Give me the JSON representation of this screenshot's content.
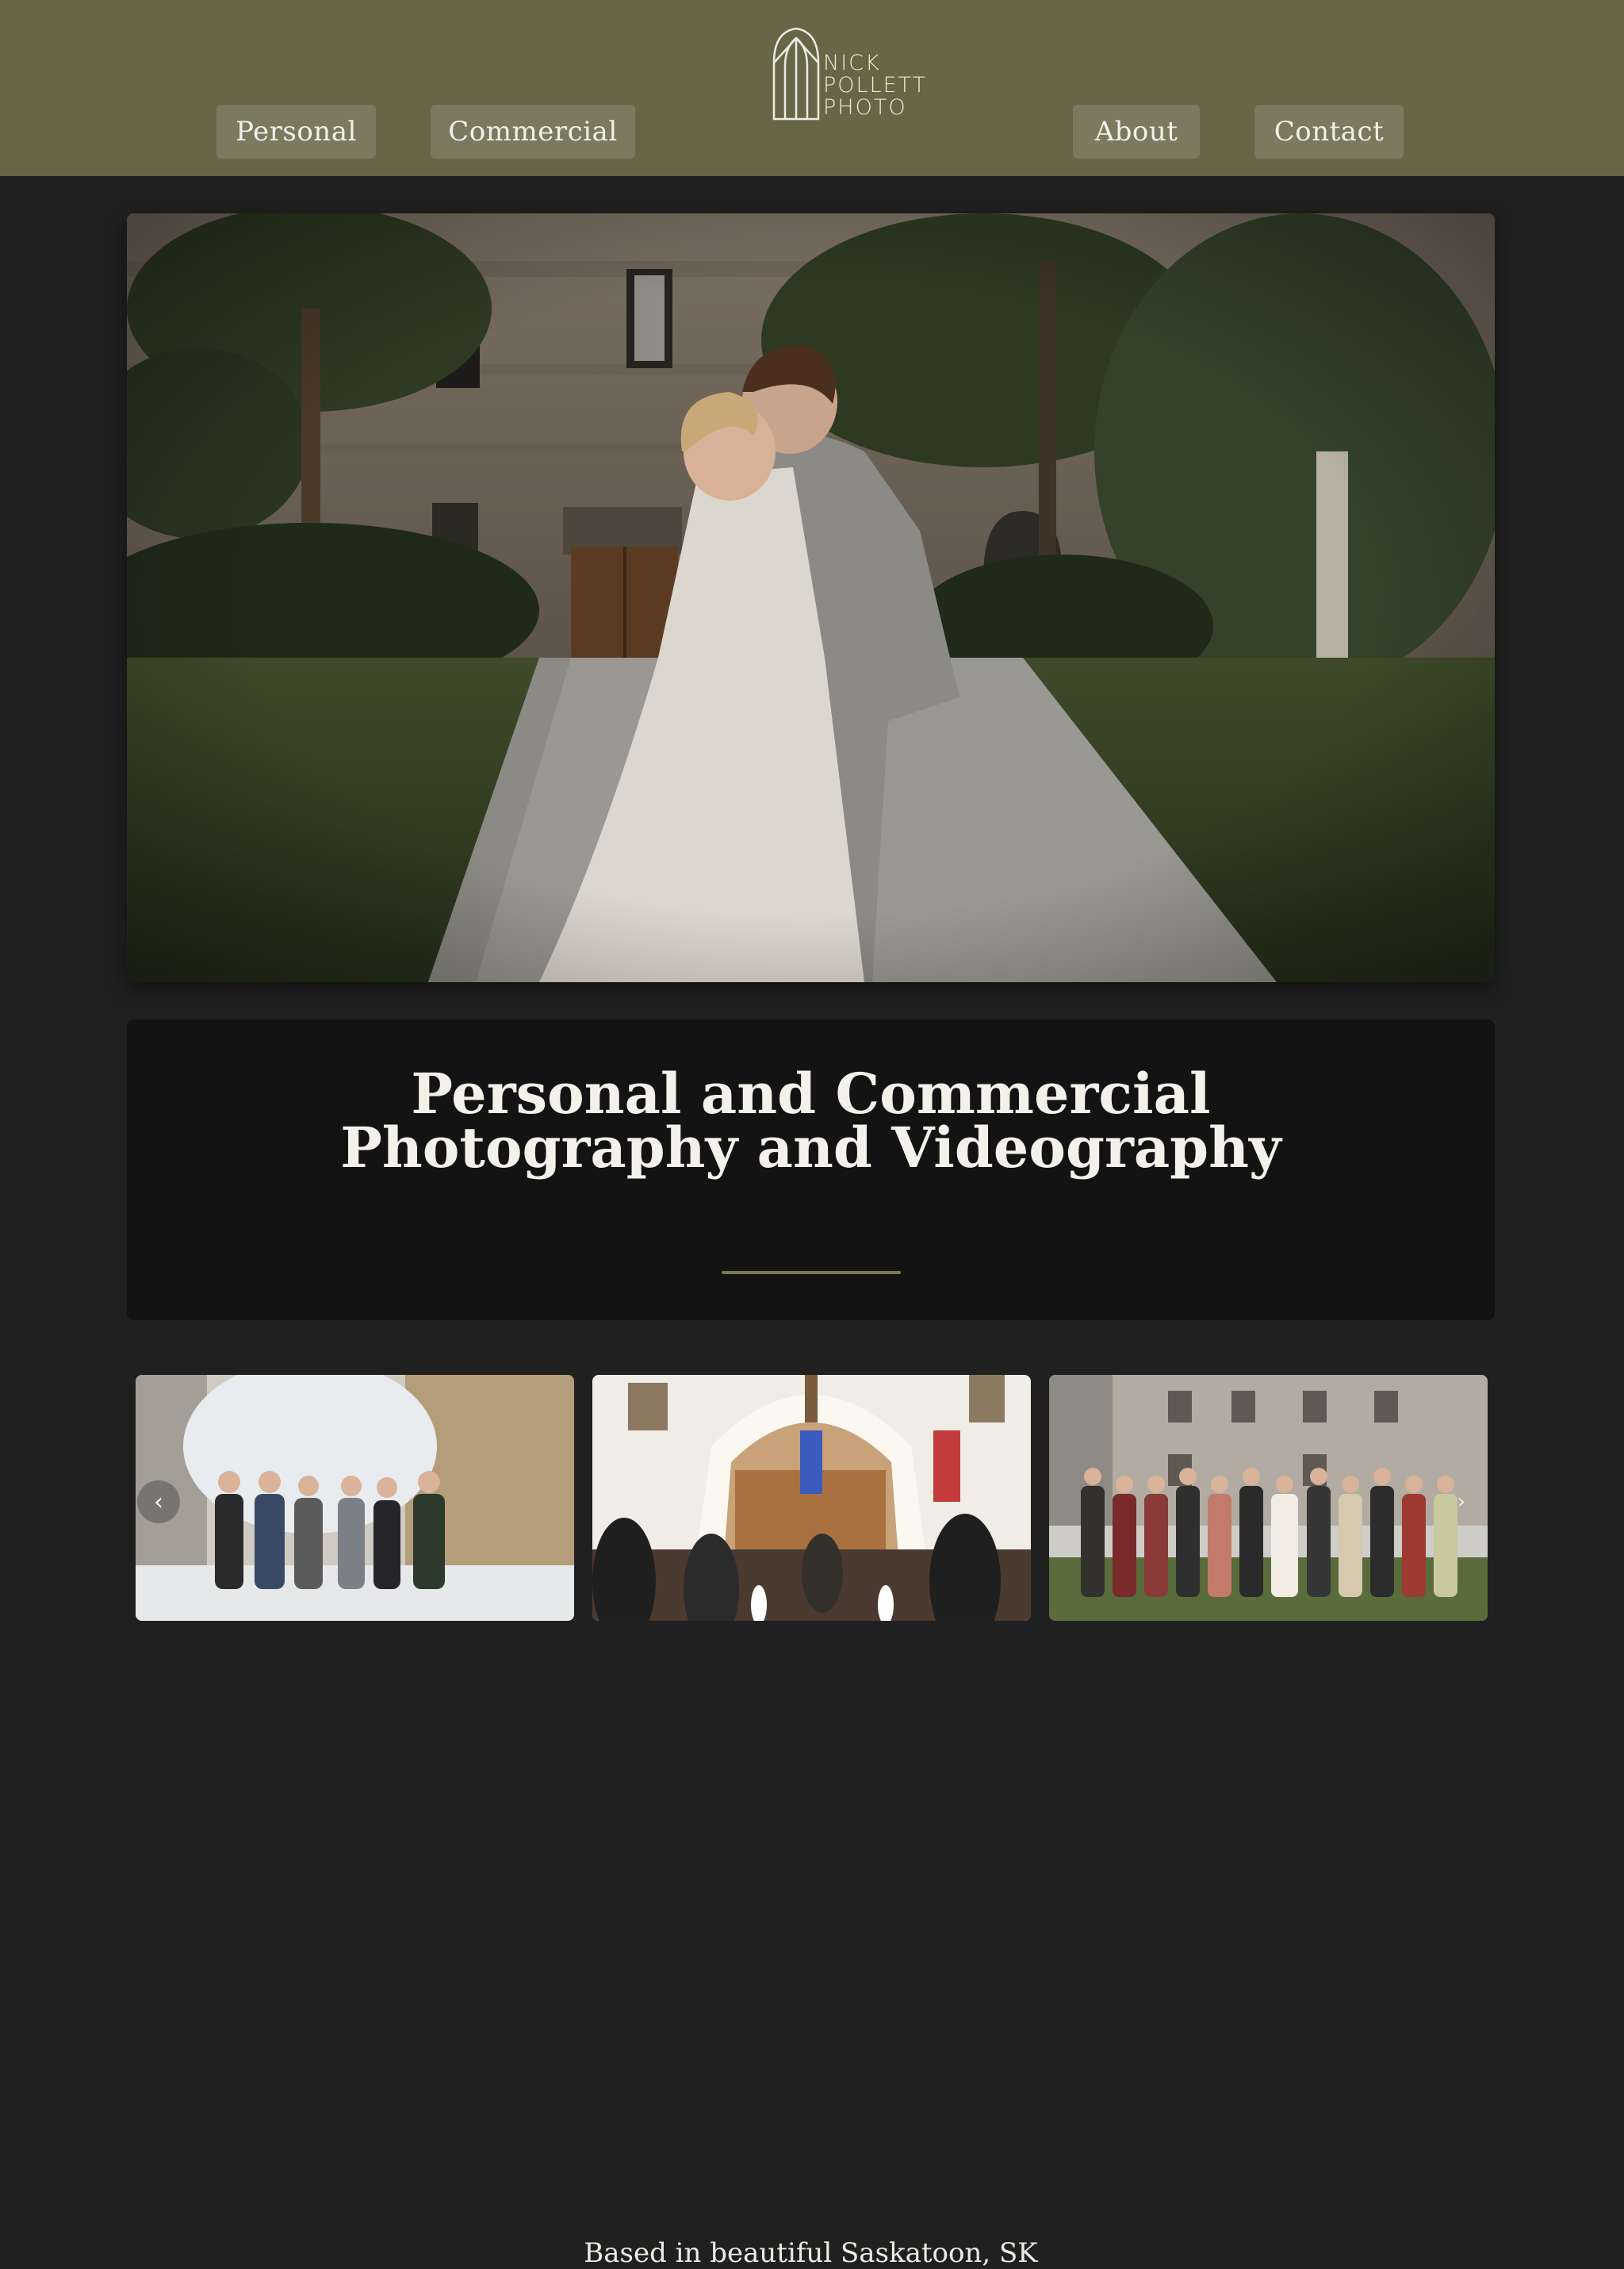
{
  "nav": {
    "personal": "Personal",
    "commercial": "Commercial",
    "about": "About",
    "contact": "Contact"
  },
  "logo": {
    "line1": "NICK",
    "line2": "POLLETT",
    "line3": "PHOTO"
  },
  "hero": {
    "title": "Personal and Commercial Photography and Videography",
    "subtitle": "Based in beautiful Saskatoon, SK"
  },
  "gallery": {
    "prev_icon": "‹",
    "next_icon": "›"
  },
  "colors": {
    "header_bg": "#676646",
    "nav_button_bg": "#7b7a60",
    "page_bg": "#202020",
    "card_bg": "#131313",
    "accent": "#7d7a52"
  }
}
